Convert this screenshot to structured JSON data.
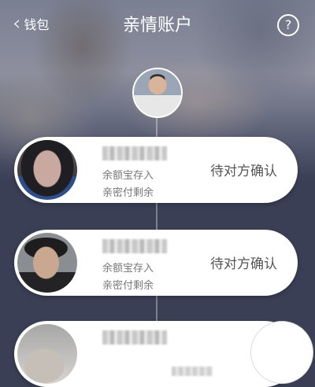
{
  "header": {
    "back_label": "钱包",
    "title": "亲情账户",
    "help_symbol": "?"
  },
  "members": [
    {
      "line1": "余额宝存入",
      "line2": "亲密付剩余",
      "status": "待对方确认"
    },
    {
      "line1": "余额宝存入",
      "line2": "亲密付剩余",
      "status": "待对方确认"
    }
  ],
  "colors": {
    "background_dark": "#3a3f55",
    "card_background": "#ffffff",
    "status_text": "#555555"
  }
}
